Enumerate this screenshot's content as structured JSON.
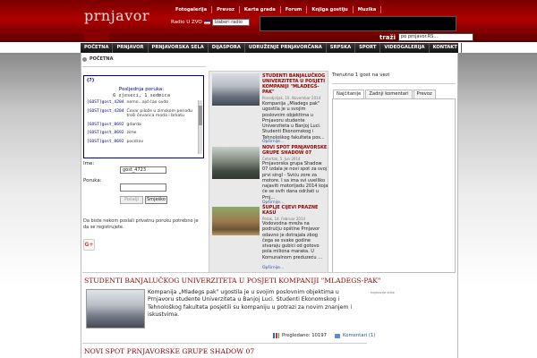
{
  "header": {
    "logo": "prnjavor",
    "topmenu": [
      "Fotogalerija",
      "Prevoz",
      "Karta grada",
      "Forum",
      "Knjiga gostiju",
      "Muzika"
    ],
    "radio_label": "Radio U ZVO",
    "radio_select": "Izaberi radio",
    "search_label": "traži",
    "search_value": "po prnjavor.RS..."
  },
  "nav": [
    "POČETNA",
    "PRNJAVOR",
    "PRNJAVORSKA SELA",
    "DIJASPORA",
    "UDRUŽENJE PRNJAVORČANA",
    "SRPSKA",
    "SPORT",
    "VIDEOGALERIJA",
    "KONTAKT"
  ],
  "breadcrumb": "POČETNA",
  "shoutbox": {
    "help": "(?)",
    "last_label": "Posljednja poruka:",
    "last_ago": "6 sjeseci, 1 sedmica",
    "messages": [
      {
        "user": "[GOST]gost_4204",
        "text": "nemo...ajd ćao ovdo"
      },
      {
        "user": "[GOST]gost_4204",
        "text": "Čovar pilože u zimskom periodu troši čevarica moda i brkatu"
      },
      {
        "user": "[GOST]gost_8692",
        "text": "gdarda"
      },
      {
        "user": "[GOST]gost_8692",
        "text": "zime"
      },
      {
        "user": "[GOST]gost_8692",
        "text": "pocdrav"
      }
    ],
    "name_label": "Ime:",
    "name_value": "gost_4723",
    "message_label": "Poruka:",
    "send_label": "Pošalji",
    "smiley_label": "Smješko",
    "notice": "Da biste nekom poslali privatnu poruku potrebno je da se registrujete."
  },
  "news": [
    {
      "title": "STUDENTI BANJALUČKOG UNIVERZITETA U POSJETI KOMPANIJI \"MLADEGS-PAK\"",
      "date": "Ponedjeljak, 10. Novembar 2014",
      "body": "Kompanija „Mladegs pak\" ugostila je u svojim poslovnim objektima u Prnjavoru studente Univerziteta u Banjoj Luci. Studenti Ekonomskog i Tehnološkog fakulteta pos...",
      "more": "Opširnije..."
    },
    {
      "title": "NOVI SPOT PRNJAVORSKE GRUPE SHADOW 07",
      "date": "Četvrtak, 5. Jun 2014",
      "body": "Prnjavorska grupa Shadow 07 izdala je novi spot za svoj prvi singl - Sviću zore za motore. I sa ima svi uvelliko najaviti motorijadu 2014 koja će se ovih dana održati u Prnj...",
      "more": "Opširnije..."
    },
    {
      "title": "ŠUPLJE CIJEVI PRAZNE KASU",
      "date": "Petak, 14. Februar 2014",
      "body": "Vodovodna mreža na području opštine Prnjavor odavno je dotrajala zbog čega se svake godine stvaraju gubici od gotovo pola miliona maraka. U Komunalnom preduzeću ...",
      "more": "Opširnije..."
    }
  ],
  "sidebar": {
    "guests": "Trenutno 1 gost na vezi",
    "tabs": [
      "Najčitanije",
      "Zadnji komentari",
      "Prevoz"
    ],
    "footer_note": "najnovije slike"
  },
  "article": {
    "title": "STUDENTI BANJALUČKOG UNIVERZITETA U POSJETI KOMPANIJI \"MLADEGS-PAK\"",
    "body": "Kompanija „Mladegs pak\" ugostila je u svojim poslovnim objektima u Prnjavoru studente Univerziteta u Banjoj Luci. Studenti Ekonomskog i Tehnološkog fakulteta posjetili su kompaniju u potrazi za novim znanjem i iskustvima.",
    "views": "Pregledano: 10197",
    "comments": "Komentari (1)"
  },
  "article2": {
    "title": "NOVI SPOT PRNJAVORSKE GRUPE SHADOW 07"
  }
}
